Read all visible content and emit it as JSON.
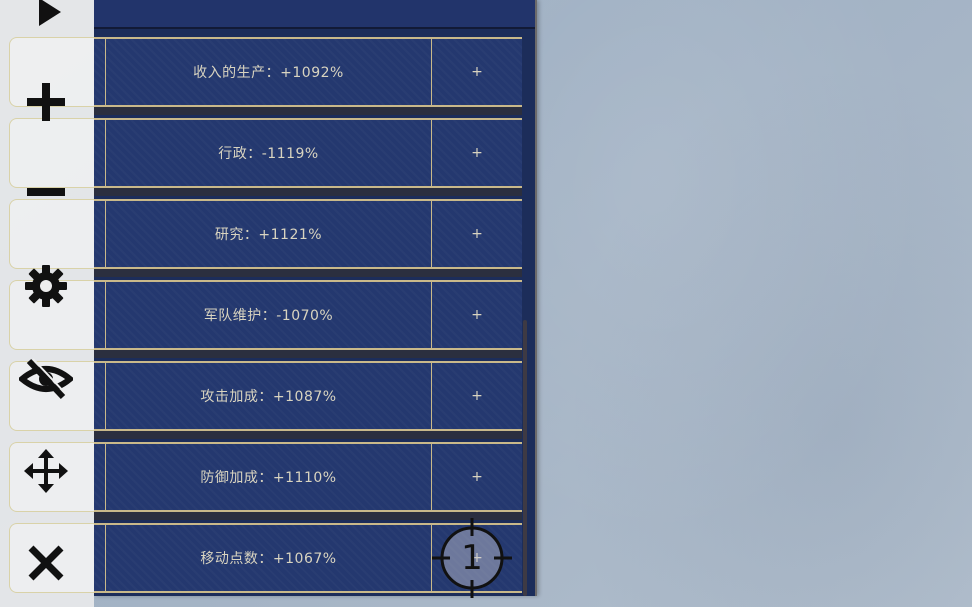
{
  "stats": [
    {
      "label": "收入的生产：+1092%",
      "button": "+"
    },
    {
      "label": "行政：-1119%",
      "button": "+"
    },
    {
      "label": "研究：+1121%",
      "button": "+"
    },
    {
      "label": "军队维护：-1070%",
      "button": "+"
    },
    {
      "label": "攻击加成：+1087%",
      "button": "+"
    },
    {
      "label": "防御加成：+1110%",
      "button": "+"
    },
    {
      "label": "移动点数：+1067%",
      "button": "+"
    }
  ],
  "toolbar": {
    "icons": [
      "play-icon",
      "plus-icon",
      "minus-icon",
      "gear-icon",
      "eye-off-icon",
      "move-icon",
      "close-icon"
    ]
  },
  "target": {
    "label": "1"
  },
  "colors": {
    "panel": "#1c2d5a",
    "row": "#24386f",
    "border_gold": "#c9b98a",
    "text": "#d9d4c0",
    "toolbar": "#eeeeee"
  }
}
